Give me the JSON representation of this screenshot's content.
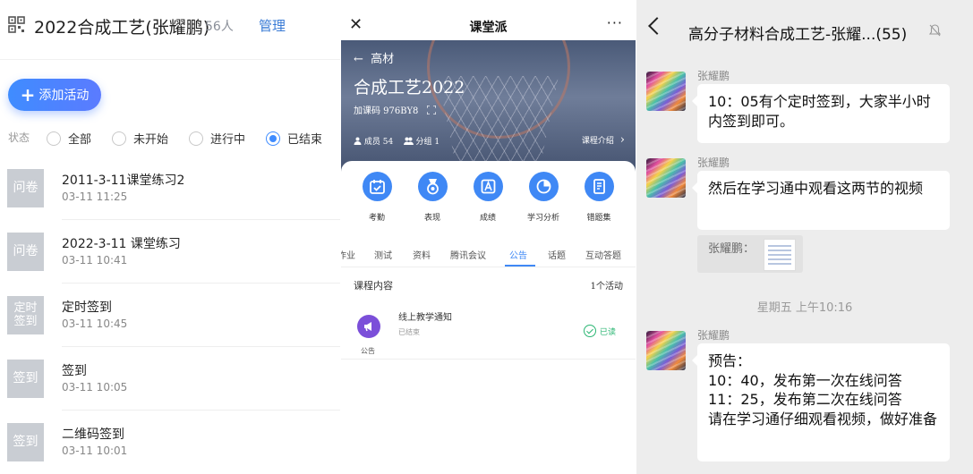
{
  "panel1": {
    "title": "2022合成工艺(张耀鹏)",
    "member_count": "56人",
    "manage_label": "管理",
    "add_activity_label": "添加活动",
    "filter_label": "状态",
    "filters": [
      {
        "label": "全部",
        "selected": false
      },
      {
        "label": "未开始",
        "selected": false
      },
      {
        "label": "进行中",
        "selected": false
      },
      {
        "label": "已结束",
        "selected": true
      }
    ],
    "activities": [
      {
        "badge": "问卷",
        "name": "2011-3-11课堂练习2",
        "time": "03-11 11:25"
      },
      {
        "badge": "问卷",
        "name": "2022-3-11 课堂练习",
        "time": "03-11 10:41"
      },
      {
        "badge": "定时\n签到",
        "name": "定时签到",
        "time": "03-11 10:45"
      },
      {
        "badge": "签到",
        "name": "签到",
        "time": "03-11 10:05"
      },
      {
        "badge": "签到",
        "name": "二维码签到",
        "time": "03-11 10:01"
      }
    ]
  },
  "panel2": {
    "close_icon": "close-icon",
    "app_title": "课堂派",
    "more_label": "···",
    "back_label": "高材",
    "course_name": "合成工艺2022",
    "join_code": "加课码 976BY8",
    "stats": "成员 54   分组 1",
    "members_label": "成员 54",
    "groups_label": "分组 1",
    "intro_label": "课程介绍",
    "tools": [
      "考勤",
      "表现",
      "成绩",
      "学习分析",
      "错题集"
    ],
    "tabs": [
      "作业",
      "测试",
      "资料",
      "腾讯会议",
      "公告",
      "话题",
      "互动答题"
    ],
    "active_tab": "公告",
    "section_title": "课程内容",
    "section_count": "1个活动",
    "notice": {
      "title": "线上教学通知",
      "status": "已结束",
      "type": "公告",
      "read": "已读"
    },
    "accent": "#3f88f5"
  },
  "panel3": {
    "group_name": "高分子材料合成工艺-张耀...(55)",
    "messages": [
      {
        "sender": "张耀鹏",
        "text": "10：05有个定时签到，大家半小时内签到即可。"
      },
      {
        "sender": "张耀鹏",
        "text": "然后在学习通中观看这两节的视频"
      },
      {
        "sender": "张耀鹏",
        "text": "预告：\n10：40，发布第一次在线问答\n11：25，发布第二次在线问答\n请在学习通仔细观看视频，做好准备"
      }
    ],
    "quote_label": "张耀鹏：",
    "timestamp": "星期五 上午10:16"
  }
}
